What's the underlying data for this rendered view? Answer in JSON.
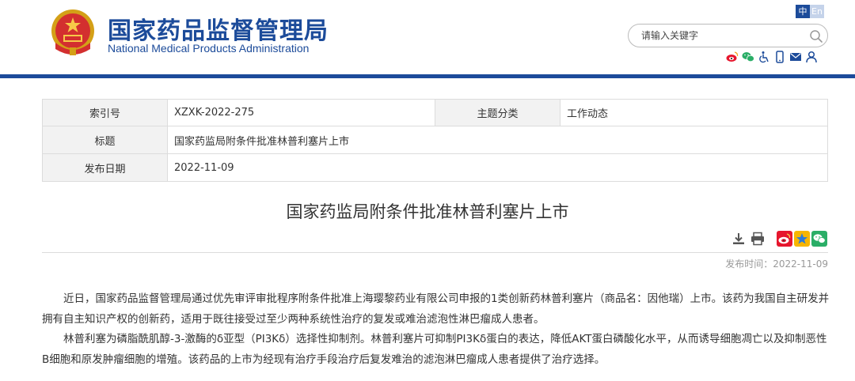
{
  "header": {
    "site_title_cn": "国家药品监督管理局",
    "site_title_en": "National Medical Products Administration",
    "lang_zh": "中",
    "lang_en": "En",
    "search_placeholder": "请输入关键字",
    "brand_color": "#1c4b9a",
    "social_icons": [
      "weibo-icon",
      "wechat-icon",
      "accessibility-icon",
      "mobile-icon",
      "mail-icon",
      "user-icon"
    ]
  },
  "info": {
    "index_label": "索引号",
    "index_value": "XZXK-2022-275",
    "topic_label": "主题分类",
    "topic_value": "工作动态",
    "title_label": "标题",
    "title_value": "国家药监局附条件批准林普利塞片上市",
    "date_label": "发布日期",
    "date_value": "2022-11-09"
  },
  "article": {
    "title": "国家药监局附条件批准林普利塞片上市",
    "publish_time": "发布时间：2022-11-09",
    "paragraphs": [
      "近日，国家药品监督管理局通过优先审评审批程序附条件批准上海璎黎药业有限公司申报的1类创新药林普利塞片（商品名：因他瑞）上市。该药为我国自主研发并拥有自主知识产权的创新药，适用于既往接受过至少两种系统性治疗的复发或难治滤泡性淋巴瘤成人患者。",
      "林普利塞为磷脂酰肌醇-3-激酶的δ亚型（PI3Kδ）选择性抑制剂。林普利塞片可抑制PI3Kδ蛋白的表达，降低AKT蛋白磷酸化水平，从而诱导细胞凋亡以及抑制恶性B细胞和原发肿瘤细胞的增殖。该药品的上市为经现有治疗手段治疗后复发难治的滤泡淋巴瘤成人患者提供了治疗选择。"
    ]
  }
}
